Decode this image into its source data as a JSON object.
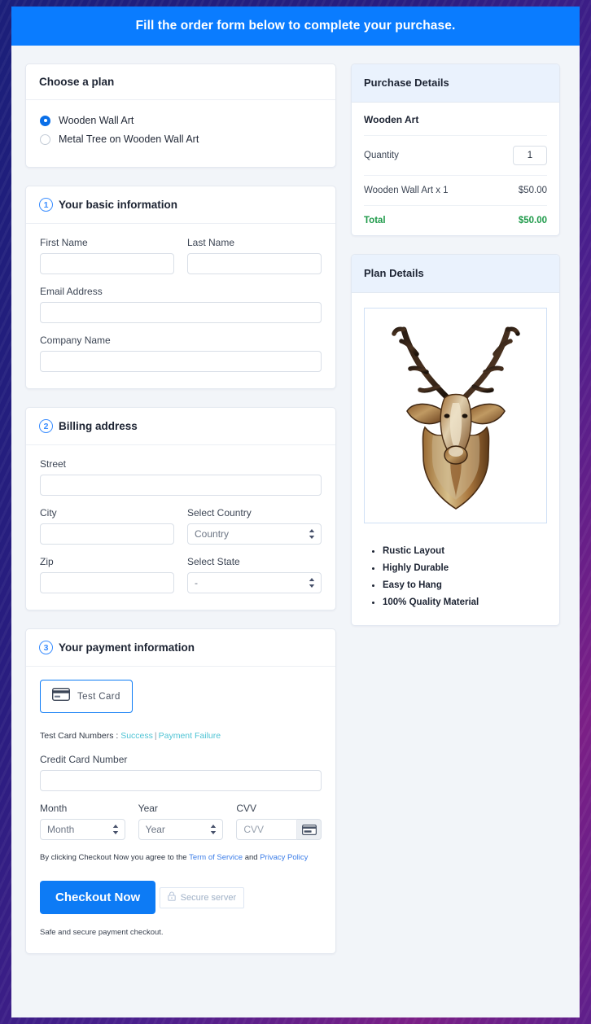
{
  "banner": {
    "text": "Fill the order form below to complete your purchase."
  },
  "plan_card": {
    "title": "Choose a plan",
    "options": [
      {
        "label": "Wooden Wall Art",
        "selected": true
      },
      {
        "label": "Metal Tree on Wooden Wall Art",
        "selected": false
      }
    ]
  },
  "basic_info": {
    "step": "1",
    "title": "Your basic information",
    "first_name": {
      "label": "First Name",
      "value": "",
      "placeholder": ""
    },
    "last_name": {
      "label": "Last Name",
      "value": "",
      "placeholder": ""
    },
    "email": {
      "label": "Email Address",
      "value": "",
      "placeholder": ""
    },
    "company": {
      "label": "Company Name",
      "value": "",
      "placeholder": ""
    }
  },
  "billing": {
    "step": "2",
    "title": "Billing address",
    "street": {
      "label": "Street",
      "value": "",
      "placeholder": ""
    },
    "city": {
      "label": "City",
      "value": "",
      "placeholder": ""
    },
    "country": {
      "label": "Select Country",
      "value": "Country"
    },
    "zip": {
      "label": "Zip",
      "value": "",
      "placeholder": ""
    },
    "state": {
      "label": "Select State",
      "value": "-"
    }
  },
  "payment": {
    "step": "3",
    "title": "Your payment information",
    "test_card_button": "Test  Card",
    "test_numbers_prefix": "Test Card Numbers : ",
    "test_numbers_success": "Success",
    "test_numbers_separator": "|",
    "test_numbers_failure": "Payment Failure",
    "card_number": {
      "label": "Credit Card Number",
      "value": "",
      "placeholder": ""
    },
    "month": {
      "label": "Month",
      "value": "Month"
    },
    "year": {
      "label": "Year",
      "value": "Year"
    },
    "cvv": {
      "label": "CVV",
      "value": "",
      "placeholder": "CVV"
    },
    "terms_prefix": "By clicking Checkout Now you agree to the ",
    "terms_link1": "Term of Service",
    "terms_middle": " and ",
    "terms_link2": "Privacy Policy",
    "checkout_button": "Checkout Now",
    "secure_badge": "Secure server",
    "safe_note": "Safe and secure payment checkout."
  },
  "purchase_details": {
    "title": "Purchase Details",
    "product_name": "Wooden Art",
    "quantity_label": "Quantity",
    "quantity_value": "1",
    "line_item_label": "Wooden Wall Art x 1",
    "line_item_price": "$50.00",
    "total_label": "Total",
    "total_value": "$50.00"
  },
  "plan_details": {
    "title": "Plan Details",
    "image_alt": "wooden-deer-wall-art",
    "features": [
      "Rustic Layout",
      "Highly Durable",
      "Easy to Hang",
      "100% Quality Material"
    ]
  },
  "colors": {
    "accent": "#0d7bf5",
    "banner": "#0a7cff",
    "total_green": "#1f9a4a",
    "test_link_teal": "#4ec3d4",
    "terms_link_blue": "#3d7ee8",
    "page_bg": "#f2f5f9"
  }
}
